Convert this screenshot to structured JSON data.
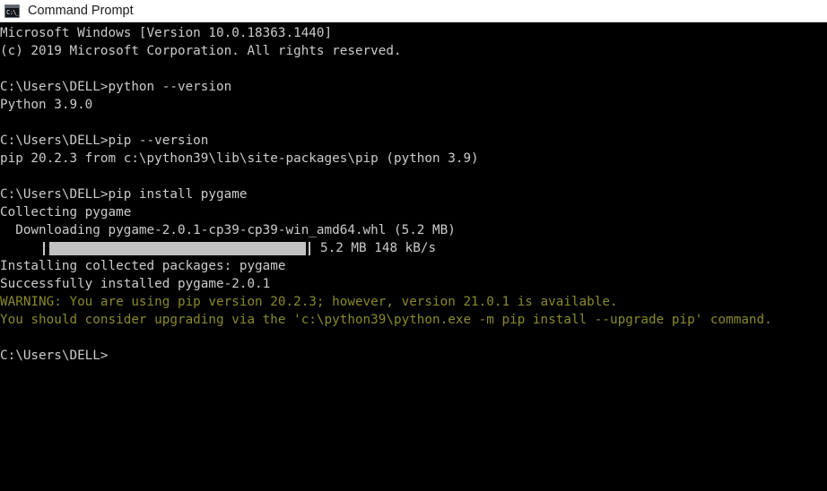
{
  "window": {
    "title": "Command Prompt",
    "icon": "command-prompt-icon",
    "icon_glyph": "C:\\_"
  },
  "theme": {
    "background": "#000000",
    "foreground": "#cccccc",
    "warning": "#8a8a2b",
    "titlebar_background": "#ffffff",
    "titlebar_text": "#1b1b1b",
    "progress_fill": "#c2c2c2"
  },
  "console": {
    "lines": [
      {
        "type": "text",
        "text": "Microsoft Windows [Version 10.0.18363.1440]"
      },
      {
        "type": "text",
        "text": "(c) 2019 Microsoft Corporation. All rights reserved."
      },
      {
        "type": "blank",
        "text": ""
      },
      {
        "type": "text",
        "text": "C:\\Users\\DELL>python --version"
      },
      {
        "type": "text",
        "text": "Python 3.9.0"
      },
      {
        "type": "blank",
        "text": ""
      },
      {
        "type": "text",
        "text": "C:\\Users\\DELL>pip --version"
      },
      {
        "type": "text",
        "text": "pip 20.2.3 from c:\\python39\\lib\\site-packages\\pip (python 3.9)"
      },
      {
        "type": "blank",
        "text": ""
      },
      {
        "type": "text",
        "text": "C:\\Users\\DELL>pip install pygame"
      },
      {
        "type": "text",
        "text": "Collecting pygame"
      },
      {
        "type": "text",
        "text": "  Downloading pygame-2.0.1-cp39-cp39-win_amd64.whl (5.2 MB)"
      },
      {
        "type": "progress",
        "text": "",
        "stats": "5.2 MB 148 kB/s",
        "percent": 100
      },
      {
        "type": "text",
        "text": "Installing collected packages: pygame"
      },
      {
        "type": "text",
        "text": "Successfully installed pygame-2.0.1"
      },
      {
        "type": "warn",
        "text": "WARNING: You are using pip version 20.2.3; however, version 21.0.1 is available."
      },
      {
        "type": "warn",
        "text": "You should consider upgrading via the 'c:\\python39\\python.exe -m pip install --upgrade pip' command."
      },
      {
        "type": "blank",
        "text": ""
      },
      {
        "type": "text",
        "text": "C:\\Users\\DELL>"
      }
    ],
    "prompt": "C:\\Users\\DELL>"
  }
}
